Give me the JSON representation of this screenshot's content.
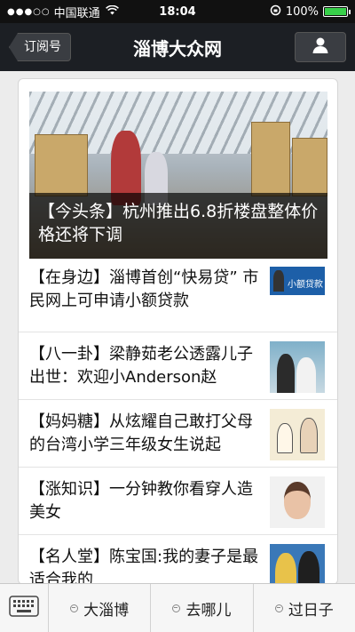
{
  "status_bar": {
    "carrier": "中国联通",
    "time": "18:04",
    "battery": "100%",
    "battery_level": 1.0
  },
  "nav": {
    "back_label": "订阅号",
    "title": "淄博大众网",
    "profile_icon": "person-icon"
  },
  "hero": {
    "caption": "【今头条】杭州推出6.8折楼盘整体价格还将下调"
  },
  "articles": [
    {
      "title": "【在身边】淄博首创“快易贷” 市民网上可申请小额贷款"
    },
    {
      "title": "【八一卦】梁静茹老公透露儿子出世：欢迎小Anderson赵"
    },
    {
      "title": "【妈妈糖】从炫耀自己敢打父母的台湾小学三年级女生说起"
    },
    {
      "title": "【涨知识】一分钟教你看穿人造美女"
    },
    {
      "title": "【名人堂】陈宝国:我的妻子是最适合我的"
    }
  ],
  "thumb_texts": {
    "loan_banner": "小额贷款"
  },
  "tabbar": {
    "keyboard_icon": "keyboard-icon",
    "tabs": [
      {
        "label": "大淄博"
      },
      {
        "label": "去哪儿"
      },
      {
        "label": "过日子"
      }
    ]
  },
  "colors": {
    "navbar": "#1c1f24",
    "battery_fill": "#38d04a"
  }
}
